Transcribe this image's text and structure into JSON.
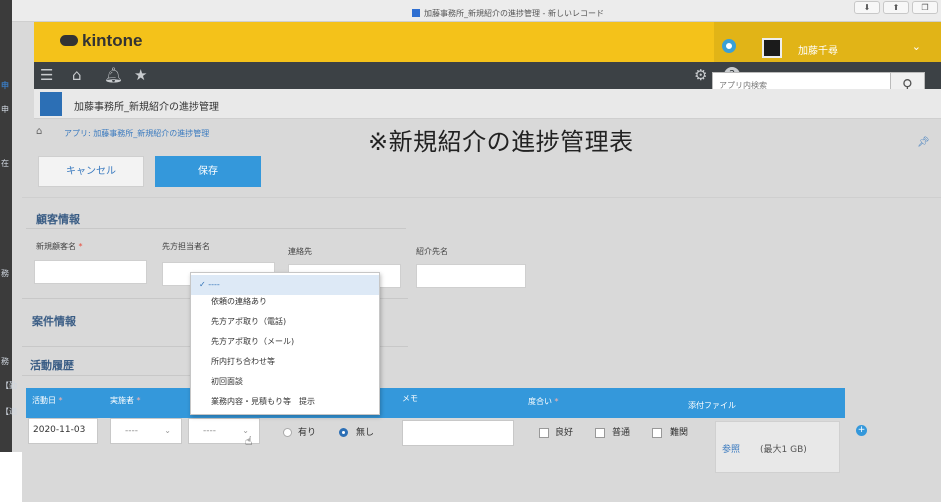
{
  "browser": {
    "tab_title": "加藤事務所_新規紹介の進捗管理 - 新しいレコード",
    "btn_download": "⬇",
    "btn_share": "⬆",
    "btn_tabs": "❐"
  },
  "left_strip": [
    "申",
    "申",
    "在",
    "務",
    "務",
    "【勤",
    "【適"
  ],
  "header": {
    "logo": "kintone",
    "user_name": "加藤千尋",
    "search_placeholder": "アプリ内検索"
  },
  "app": {
    "title": "加藤事務所_新規紹介の進捗管理",
    "breadcrumb": "アプリ: 加藤事務所_新規紹介の進捗管理",
    "overlay_title": "※新規紹介の進捗管理表"
  },
  "actions": {
    "cancel": "キャンセル",
    "save": "保存"
  },
  "sections": {
    "customer": "顧客情報",
    "case": "案件情報",
    "activity": "活動履歴"
  },
  "customer_fields": {
    "new_customer": "新規顧客名",
    "contact_person": "先方担当者名",
    "contact": "連絡先",
    "referrer": "紹介先名"
  },
  "dropdown": {
    "selected": "✓ ----",
    "options": [
      "依頼の連絡あり",
      "先方アポ取り（電話)",
      "先方アポ取り（メール)",
      "所内打ち合わせ等",
      "初回面談",
      "業務内容・見積もり等　提示"
    ]
  },
  "table": {
    "headers": {
      "date": "活動日",
      "person": "実施者",
      "memo": "メモ",
      "level": "度合い",
      "attachment": "添付ファイル"
    },
    "row": {
      "date": "2020-11-03",
      "person_value": "----",
      "status_value": "----",
      "radio_yes": "有り",
      "radio_no": "無し",
      "chk_good": "良好",
      "chk_normal": "普通",
      "chk_hard": "難関",
      "browse": "参照",
      "max_size": "(最大1 GB)"
    }
  }
}
